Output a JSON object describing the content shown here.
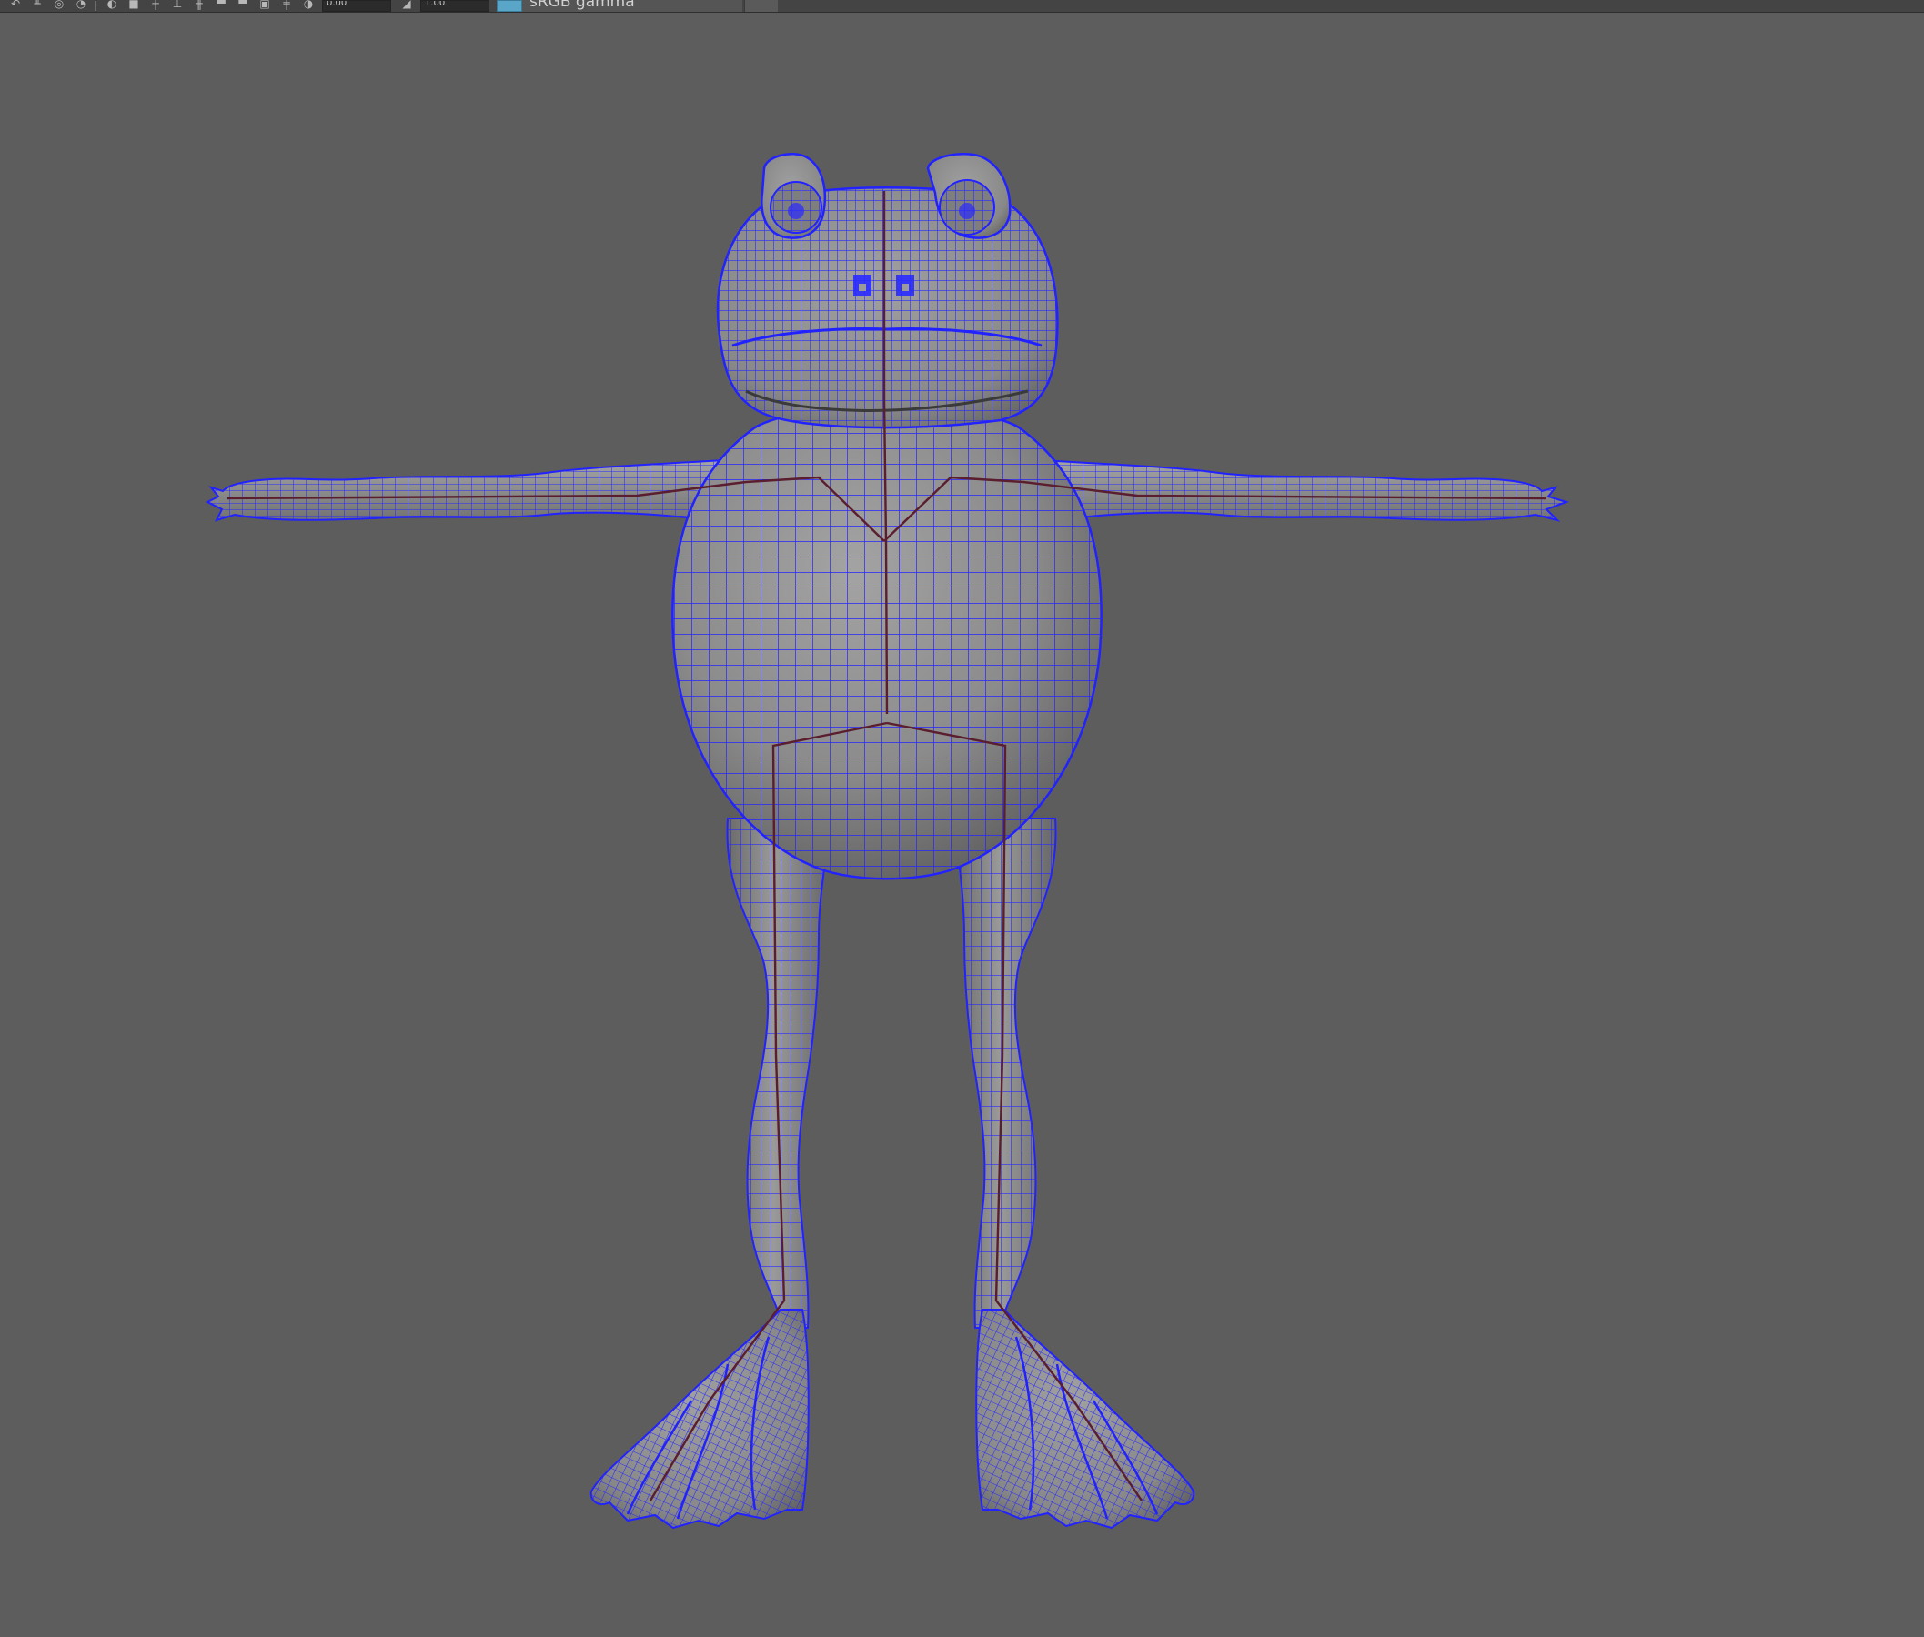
{
  "toolbar": {
    "field_1": "0.00",
    "field_2": "1.00",
    "color_space": "sRGB gamma",
    "icons": [
      "undo-icon",
      "gate-icon",
      "camera-orbit-icon",
      "camera-tumble-icon",
      "shading-icon",
      "layer-icon",
      "grid-icon",
      "pivot-icon",
      "isolate-icon",
      "solid-box-icon",
      "solid-box-icon",
      "resolution-gate-icon",
      "film-gate-icon",
      "exposure-icon",
      "gamma-icon",
      "color-management-icon"
    ]
  },
  "viewport": {
    "background": "#5d5d5d",
    "wireframe_color": "#2020ff",
    "joint_color": "#5a1e2e",
    "model": "frog-tpose-wireframe-on-shaded"
  }
}
